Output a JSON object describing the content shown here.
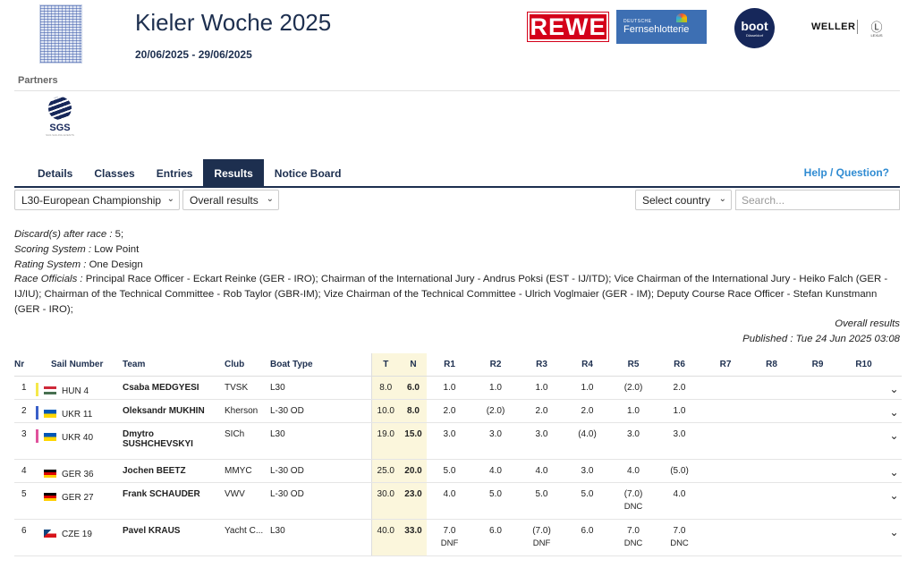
{
  "event": {
    "title": "Kieler Woche 2025",
    "dates": "20/06/2025 - 29/06/2025",
    "logo_icon": "kieler-woche-logo"
  },
  "sponsors": {
    "rewe": "REWE",
    "lotterie_small": "DEUTSCHE",
    "lotterie_big": "Fernsehlotterie",
    "boot": "boot",
    "boot_sub": "Düsseldorf",
    "weller": "WELLER",
    "lexus_icon": "lexus-logo",
    "lexus_sub": "LEXUS"
  },
  "partners": {
    "label": "Partners",
    "sgs": "SGS",
    "sgs_sub": "SGS SAILING EVENTS"
  },
  "tabs": [
    {
      "label": "Details",
      "active": false
    },
    {
      "label": "Classes",
      "active": false
    },
    {
      "label": "Entries",
      "active": false
    },
    {
      "label": "Results",
      "active": true
    },
    {
      "label": "Notice Board",
      "active": false
    }
  ],
  "help_link": "Help / Question?",
  "filters": {
    "class_select": "L30-European Championship",
    "results_select": "Overall results",
    "country_select": "Select country",
    "search_placeholder": "Search..."
  },
  "info": {
    "discards_label": "Discard(s) after race :",
    "discards_value": " 5;",
    "scoring_label": "Scoring System :",
    "scoring_value": " Low Point",
    "rating_label": "Rating System :",
    "rating_value": " One Design",
    "officials_label": "Race Officials :",
    "officials_value": " Principal Race Officer - Eckart Reinke (GER - IRO); Chairman of the International Jury - Andrus Poksi (EST - IJ/ITD); Vice Chairman of the International Jury - Heiko Falch (GER - IJ/IU); Chairman of the Technical Committee - Rob Taylor (GBR-IM); Vize Chairman of the Technical Committee - Ulrich Voglmaier (GER - IM); Deputy Course Race Officer - Stefan Kunstmann (GER - IRO);"
  },
  "published": {
    "title": "Overall results",
    "label": "Published :",
    "value": " Tue 24 Jun 2025 03:08"
  },
  "table": {
    "headers": [
      "Nr",
      "Sail Number",
      "Team",
      "Club",
      "Boat Type",
      "T",
      "N",
      "R1",
      "R2",
      "R3",
      "R4",
      "R5",
      "R6",
      "R7",
      "R8",
      "R9",
      "R10"
    ],
    "rows": [
      {
        "nr": "1",
        "bar_color": "#f5e84a",
        "flag": "HUN",
        "sail": "HUN 4",
        "team": "Csaba MEDGYESI",
        "club": "TVSK",
        "boat": "L30",
        "t": "8.0",
        "n": "6.0",
        "races": [
          {
            "v": "1.0",
            "c": ""
          },
          {
            "v": "1.0",
            "c": ""
          },
          {
            "v": "1.0",
            "c": ""
          },
          {
            "v": "1.0",
            "c": ""
          },
          {
            "v": "(2.0)",
            "c": ""
          },
          {
            "v": "2.0",
            "c": ""
          }
        ]
      },
      {
        "nr": "2",
        "bar_color": "#3a5fc8",
        "flag": "UKR",
        "sail": "UKR 11",
        "team": "Oleksandr MUKHIN",
        "club": "Kherson",
        "boat": "L-30 OD",
        "t": "10.0",
        "n": "8.0",
        "races": [
          {
            "v": "2.0",
            "c": ""
          },
          {
            "v": "(2.0)",
            "c": ""
          },
          {
            "v": "2.0",
            "c": ""
          },
          {
            "v": "2.0",
            "c": ""
          },
          {
            "v": "1.0",
            "c": ""
          },
          {
            "v": "1.0",
            "c": ""
          }
        ]
      },
      {
        "nr": "3",
        "bar_color": "#e0529c",
        "flag": "UKR",
        "sail": "UKR 40",
        "team": "Dmytro SUSHCHEVSKYI",
        "club": "SICh",
        "boat": "L30",
        "t": "19.0",
        "n": "15.0",
        "races": [
          {
            "v": "3.0",
            "c": ""
          },
          {
            "v": "3.0",
            "c": ""
          },
          {
            "v": "3.0",
            "c": ""
          },
          {
            "v": "(4.0)",
            "c": ""
          },
          {
            "v": "3.0",
            "c": ""
          },
          {
            "v": "3.0",
            "c": ""
          }
        ]
      },
      {
        "nr": "4",
        "bar_color": "",
        "flag": "GER",
        "sail": "GER 36",
        "team": "Jochen BEETZ",
        "club": "MMYC",
        "boat": "L-30 OD",
        "t": "25.0",
        "n": "20.0",
        "races": [
          {
            "v": "5.0",
            "c": ""
          },
          {
            "v": "4.0",
            "c": ""
          },
          {
            "v": "4.0",
            "c": ""
          },
          {
            "v": "3.0",
            "c": ""
          },
          {
            "v": "4.0",
            "c": ""
          },
          {
            "v": "(5.0)",
            "c": ""
          }
        ]
      },
      {
        "nr": "5",
        "bar_color": "",
        "flag": "GER",
        "sail": "GER 27",
        "team": "Frank SCHAUDER",
        "club": "VWV",
        "boat": "L-30 OD",
        "t": "30.0",
        "n": "23.0",
        "races": [
          {
            "v": "4.0",
            "c": ""
          },
          {
            "v": "5.0",
            "c": ""
          },
          {
            "v": "5.0",
            "c": ""
          },
          {
            "v": "5.0",
            "c": ""
          },
          {
            "v": "(7.0)",
            "c": "DNC"
          },
          {
            "v": "4.0",
            "c": ""
          }
        ]
      },
      {
        "nr": "6",
        "bar_color": "",
        "flag": "CZE",
        "sail": "CZE 19",
        "team": "Pavel KRAUS",
        "club": "Yacht C...",
        "boat": "L30",
        "t": "40.0",
        "n": "33.0",
        "races": [
          {
            "v": "7.0",
            "c": "DNF"
          },
          {
            "v": "6.0",
            "c": ""
          },
          {
            "v": "(7.0)",
            "c": "DNF"
          },
          {
            "v": "6.0",
            "c": ""
          },
          {
            "v": "7.0",
            "c": "DNC"
          },
          {
            "v": "7.0",
            "c": "DNC"
          }
        ]
      }
    ]
  }
}
